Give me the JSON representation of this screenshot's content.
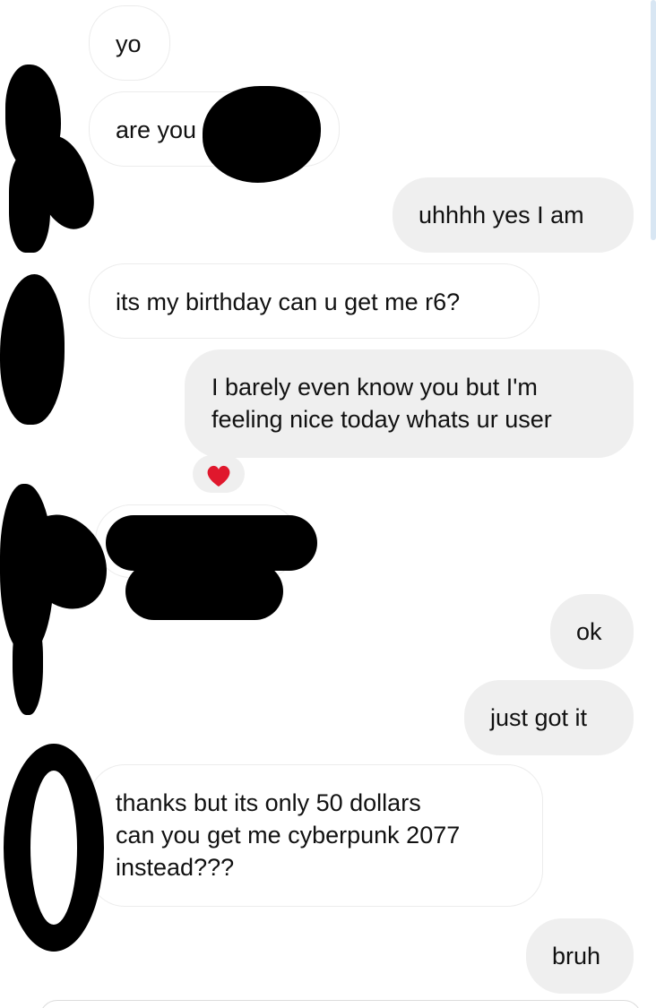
{
  "messages": [
    {
      "id": "m1",
      "side": "incoming",
      "text": "yo"
    },
    {
      "id": "m2",
      "side": "incoming",
      "text": "are you"
    },
    {
      "id": "m3",
      "side": "outgoing",
      "text": "uhhhh yes I am"
    },
    {
      "id": "m4",
      "side": "incoming",
      "text": "its my birthday can u get me r6?"
    },
    {
      "id": "m5",
      "side": "outgoing",
      "lines": [
        "I barely even know you but I'm",
        "feeling nice today whats ur user"
      ]
    },
    {
      "id": "m6",
      "side": "incoming",
      "text": ""
    },
    {
      "id": "m7",
      "side": "outgoing",
      "text": "ok"
    },
    {
      "id": "m8",
      "side": "outgoing",
      "text": "just got it"
    },
    {
      "id": "m9",
      "side": "incoming",
      "lines": [
        "thanks but its only 50 dollars",
        "can you get me cyberpunk 2077",
        "instead???"
      ]
    },
    {
      "id": "m10",
      "side": "outgoing",
      "text": "bruh"
    }
  ],
  "reaction": {
    "emoji": "❤️",
    "icon": "heart-icon"
  },
  "colors": {
    "incoming_bubble": "#ffffff",
    "outgoing_bubble": "#efefef",
    "text": "#111111",
    "redaction": "#000000",
    "scrollbar": "#d8e6f3"
  }
}
